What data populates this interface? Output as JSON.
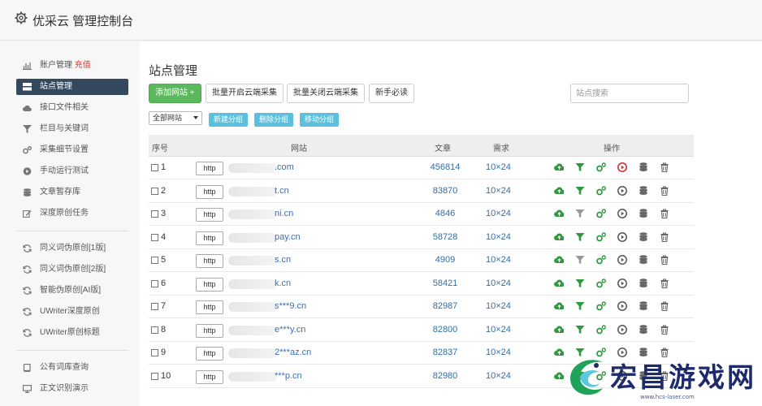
{
  "header": {
    "title": "优采云 管理控制台"
  },
  "sidebar": {
    "items": [
      {
        "label": "账户管理",
        "hot": "充值",
        "icon": "bar-chart-icon"
      },
      {
        "label": "站点管理",
        "icon": "server-icon"
      },
      {
        "label": "接口文件相关",
        "icon": "cloud-icon"
      },
      {
        "label": "栏目与关键词",
        "icon": "filter-icon"
      },
      {
        "label": "采集细节设置",
        "icon": "cogs-icon"
      },
      {
        "label": "手动运行测试",
        "icon": "play-circle-icon"
      },
      {
        "label": "文章暂存库",
        "icon": "database-icon"
      },
      {
        "label": "深度原创任务",
        "icon": "edit-icon"
      },
      {
        "label": "同义词伪原创[1版]",
        "icon": "refresh-icon"
      },
      {
        "label": "同义词伪原创[2版]",
        "icon": "refresh-icon"
      },
      {
        "label": "智能伪原创[AI版]",
        "icon": "refresh-icon"
      },
      {
        "label": "UWriter深度原创",
        "icon": "refresh-icon"
      },
      {
        "label": "UWriter原创标题",
        "icon": "refresh-icon"
      },
      {
        "label": "公有词库查询",
        "icon": "book-icon"
      },
      {
        "label": "正文识别演示",
        "icon": "monitor-icon"
      }
    ]
  },
  "main": {
    "title": "站点管理",
    "toolbar": {
      "add_site": "添加网站 +",
      "batch_open": "批量开启云端采集",
      "batch_close": "批量关闭云端采集",
      "guide": "新手必读",
      "search_placeholder": "站点搜索"
    },
    "filter": {
      "select_value": "全部网站",
      "new_group": "新建分组",
      "delete_group": "删除分组",
      "move_group": "移动分组"
    },
    "table": {
      "headers": {
        "no": "序号",
        "site": "网站",
        "articles": "文章",
        "demand": "需求",
        "actions": "操作"
      },
      "rows": [
        {
          "no": "1",
          "protocol": "http",
          "domain": ".com",
          "articles": "456814",
          "demand": "10×24"
        },
        {
          "no": "2",
          "protocol": "http",
          "domain": "t.cn",
          "articles": "83870",
          "demand": "10×24"
        },
        {
          "no": "3",
          "protocol": "http",
          "domain": "ni.cn",
          "articles": "4846",
          "demand": "10×24"
        },
        {
          "no": "4",
          "protocol": "http",
          "domain": "pay.cn",
          "articles": "58728",
          "demand": "10×24"
        },
        {
          "no": "5",
          "protocol": "http",
          "domain": "s.cn",
          "articles": "4909",
          "demand": "10×24"
        },
        {
          "no": "6",
          "protocol": "http",
          "domain": "k.cn",
          "articles": "58421",
          "demand": "10×24"
        },
        {
          "no": "7",
          "protocol": "http",
          "domain": "s***9.cn",
          "articles": "82987",
          "demand": "10×24"
        },
        {
          "no": "8",
          "protocol": "http",
          "domain": "e***y.cn",
          "articles": "82800",
          "demand": "10×24"
        },
        {
          "no": "9",
          "protocol": "http",
          "domain": "2***az.cn",
          "articles": "82837",
          "demand": "10×24"
        },
        {
          "no": "10",
          "protocol": "http",
          "domain": "***p.cn",
          "articles": "82980",
          "demand": "10×24"
        }
      ]
    }
  },
  "watermark": {
    "brand": "宏昌游戏网",
    "url": "www.hcs-laser.com"
  },
  "colors": {
    "sidebar_active": "#34495e",
    "add_button": "#5cb85c",
    "group_button": "#5bc0de",
    "link": "#2f6ea8",
    "hot": "#e0332d"
  }
}
